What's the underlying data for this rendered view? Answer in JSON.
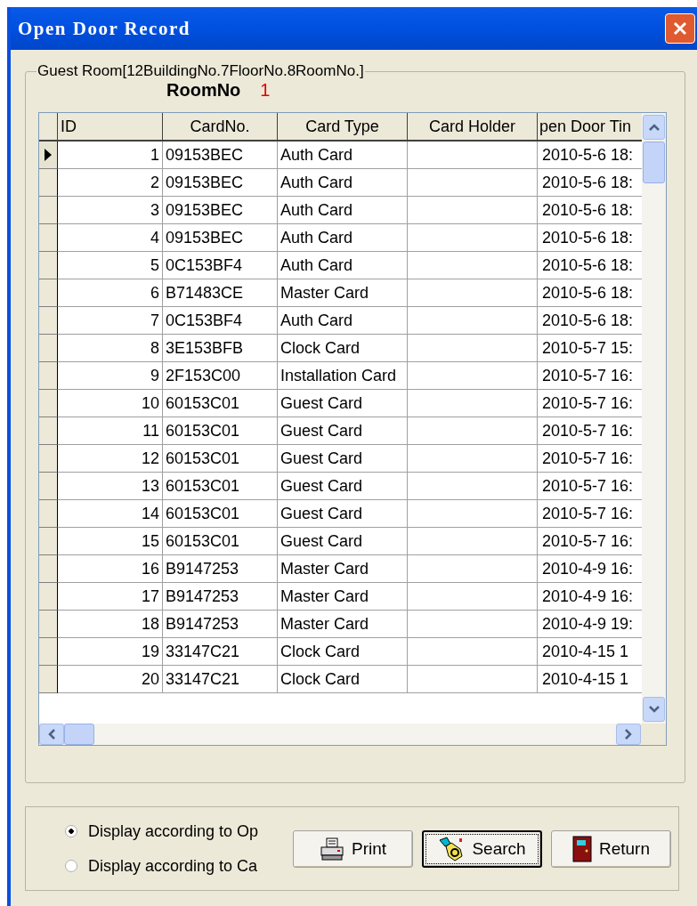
{
  "window": {
    "title": "Open Door Record"
  },
  "room_group": {
    "title": "Guest Room[12BuildingNo.7FloorNo.8RoomNo.]",
    "room_label": "RoomNo",
    "room_value": "1"
  },
  "table": {
    "columns": [
      "ID",
      "CardNo.",
      "Card Type",
      "Card Holder",
      "pen Door Tin"
    ],
    "rows": [
      {
        "selected": true,
        "cells": [
          "1",
          "09153BEC",
          "Auth Card",
          "",
          "2010-5-6 18:"
        ]
      },
      {
        "selected": false,
        "cells": [
          "2",
          "09153BEC",
          "Auth Card",
          "",
          "2010-5-6 18:"
        ]
      },
      {
        "selected": false,
        "cells": [
          "3",
          "09153BEC",
          "Auth Card",
          "",
          "2010-5-6 18:"
        ]
      },
      {
        "selected": false,
        "cells": [
          "4",
          "09153BEC",
          "Auth Card",
          "",
          "2010-5-6 18:"
        ]
      },
      {
        "selected": false,
        "cells": [
          "5",
          "0C153BF4",
          "Auth Card",
          "",
          "2010-5-6 18:"
        ]
      },
      {
        "selected": false,
        "cells": [
          "6",
          "B71483CE",
          "Master Card",
          "",
          "2010-5-6 18:"
        ]
      },
      {
        "selected": false,
        "cells": [
          "7",
          "0C153BF4",
          "Auth Card",
          "",
          "2010-5-6 18:"
        ]
      },
      {
        "selected": false,
        "cells": [
          "8",
          "3E153BFB",
          "Clock Card",
          "",
          "2010-5-7 15:"
        ]
      },
      {
        "selected": false,
        "cells": [
          "9",
          "2F153C00",
          "Installation Card",
          "",
          "2010-5-7 16:"
        ]
      },
      {
        "selected": false,
        "cells": [
          "10",
          "60153C01",
          "Guest Card",
          "",
          "2010-5-7 16:"
        ]
      },
      {
        "selected": false,
        "cells": [
          "11",
          "60153C01",
          "Guest Card",
          "",
          "2010-5-7 16:"
        ]
      },
      {
        "selected": false,
        "cells": [
          "12",
          "60153C01",
          "Guest Card",
          "",
          "2010-5-7 16:"
        ]
      },
      {
        "selected": false,
        "cells": [
          "13",
          "60153C01",
          "Guest Card",
          "",
          "2010-5-7 16:"
        ]
      },
      {
        "selected": false,
        "cells": [
          "14",
          "60153C01",
          "Guest Card",
          "",
          "2010-5-7 16:"
        ]
      },
      {
        "selected": false,
        "cells": [
          "15",
          "60153C01",
          "Guest Card",
          "",
          "2010-5-7 16:"
        ]
      },
      {
        "selected": false,
        "cells": [
          "16",
          "B9147253",
          "Master Card",
          "",
          "2010-4-9 16:"
        ]
      },
      {
        "selected": false,
        "cells": [
          "17",
          "B9147253",
          "Master Card",
          "",
          "2010-4-9 16:"
        ]
      },
      {
        "selected": false,
        "cells": [
          "18",
          "B9147253",
          "Master Card",
          "",
          "2010-4-9 19:"
        ]
      },
      {
        "selected": false,
        "cells": [
          "19",
          "33147C21",
          "Clock Card",
          "",
          "2010-4-15 1"
        ]
      },
      {
        "selected": false,
        "cells": [
          "20",
          "33147C21",
          "Clock Card",
          "",
          "2010-4-15 1"
        ]
      }
    ]
  },
  "display_options": [
    {
      "label": "Display according to Op",
      "selected": true
    },
    {
      "label": "Display according to Ca",
      "selected": false
    }
  ],
  "buttons": [
    {
      "kind": "print",
      "label": "Print",
      "focused": false
    },
    {
      "kind": "search",
      "label": "Search",
      "focused": true
    },
    {
      "kind": "return",
      "label": "Return",
      "focused": false
    }
  ]
}
